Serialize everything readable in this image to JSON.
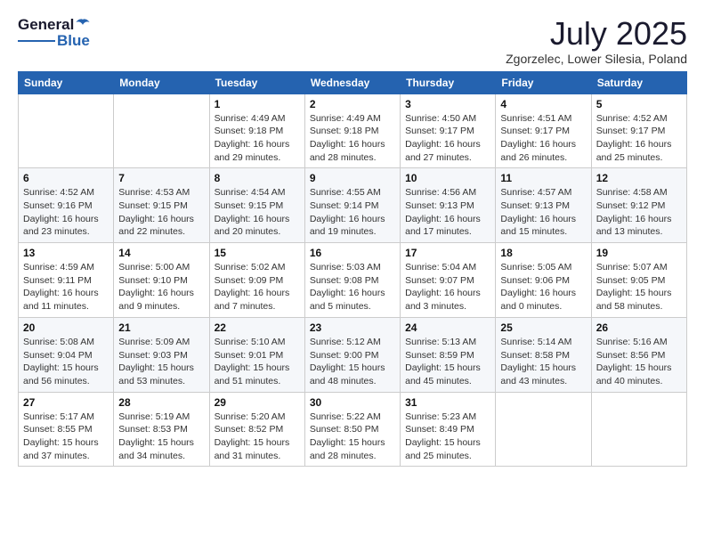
{
  "logo": {
    "general": "General",
    "blue": "Blue"
  },
  "title": "July 2025",
  "location": "Zgorzelec, Lower Silesia, Poland",
  "days_of_week": [
    "Sunday",
    "Monday",
    "Tuesday",
    "Wednesday",
    "Thursday",
    "Friday",
    "Saturday"
  ],
  "weeks": [
    [
      {
        "day": "",
        "info": ""
      },
      {
        "day": "",
        "info": ""
      },
      {
        "day": "1",
        "info": "Sunrise: 4:49 AM\nSunset: 9:18 PM\nDaylight: 16 hours\nand 29 minutes."
      },
      {
        "day": "2",
        "info": "Sunrise: 4:49 AM\nSunset: 9:18 PM\nDaylight: 16 hours\nand 28 minutes."
      },
      {
        "day": "3",
        "info": "Sunrise: 4:50 AM\nSunset: 9:17 PM\nDaylight: 16 hours\nand 27 minutes."
      },
      {
        "day": "4",
        "info": "Sunrise: 4:51 AM\nSunset: 9:17 PM\nDaylight: 16 hours\nand 26 minutes."
      },
      {
        "day": "5",
        "info": "Sunrise: 4:52 AM\nSunset: 9:17 PM\nDaylight: 16 hours\nand 25 minutes."
      }
    ],
    [
      {
        "day": "6",
        "info": "Sunrise: 4:52 AM\nSunset: 9:16 PM\nDaylight: 16 hours\nand 23 minutes."
      },
      {
        "day": "7",
        "info": "Sunrise: 4:53 AM\nSunset: 9:15 PM\nDaylight: 16 hours\nand 22 minutes."
      },
      {
        "day": "8",
        "info": "Sunrise: 4:54 AM\nSunset: 9:15 PM\nDaylight: 16 hours\nand 20 minutes."
      },
      {
        "day": "9",
        "info": "Sunrise: 4:55 AM\nSunset: 9:14 PM\nDaylight: 16 hours\nand 19 minutes."
      },
      {
        "day": "10",
        "info": "Sunrise: 4:56 AM\nSunset: 9:13 PM\nDaylight: 16 hours\nand 17 minutes."
      },
      {
        "day": "11",
        "info": "Sunrise: 4:57 AM\nSunset: 9:13 PM\nDaylight: 16 hours\nand 15 minutes."
      },
      {
        "day": "12",
        "info": "Sunrise: 4:58 AM\nSunset: 9:12 PM\nDaylight: 16 hours\nand 13 minutes."
      }
    ],
    [
      {
        "day": "13",
        "info": "Sunrise: 4:59 AM\nSunset: 9:11 PM\nDaylight: 16 hours\nand 11 minutes."
      },
      {
        "day": "14",
        "info": "Sunrise: 5:00 AM\nSunset: 9:10 PM\nDaylight: 16 hours\nand 9 minutes."
      },
      {
        "day": "15",
        "info": "Sunrise: 5:02 AM\nSunset: 9:09 PM\nDaylight: 16 hours\nand 7 minutes."
      },
      {
        "day": "16",
        "info": "Sunrise: 5:03 AM\nSunset: 9:08 PM\nDaylight: 16 hours\nand 5 minutes."
      },
      {
        "day": "17",
        "info": "Sunrise: 5:04 AM\nSunset: 9:07 PM\nDaylight: 16 hours\nand 3 minutes."
      },
      {
        "day": "18",
        "info": "Sunrise: 5:05 AM\nSunset: 9:06 PM\nDaylight: 16 hours\nand 0 minutes."
      },
      {
        "day": "19",
        "info": "Sunrise: 5:07 AM\nSunset: 9:05 PM\nDaylight: 15 hours\nand 58 minutes."
      }
    ],
    [
      {
        "day": "20",
        "info": "Sunrise: 5:08 AM\nSunset: 9:04 PM\nDaylight: 15 hours\nand 56 minutes."
      },
      {
        "day": "21",
        "info": "Sunrise: 5:09 AM\nSunset: 9:03 PM\nDaylight: 15 hours\nand 53 minutes."
      },
      {
        "day": "22",
        "info": "Sunrise: 5:10 AM\nSunset: 9:01 PM\nDaylight: 15 hours\nand 51 minutes."
      },
      {
        "day": "23",
        "info": "Sunrise: 5:12 AM\nSunset: 9:00 PM\nDaylight: 15 hours\nand 48 minutes."
      },
      {
        "day": "24",
        "info": "Sunrise: 5:13 AM\nSunset: 8:59 PM\nDaylight: 15 hours\nand 45 minutes."
      },
      {
        "day": "25",
        "info": "Sunrise: 5:14 AM\nSunset: 8:58 PM\nDaylight: 15 hours\nand 43 minutes."
      },
      {
        "day": "26",
        "info": "Sunrise: 5:16 AM\nSunset: 8:56 PM\nDaylight: 15 hours\nand 40 minutes."
      }
    ],
    [
      {
        "day": "27",
        "info": "Sunrise: 5:17 AM\nSunset: 8:55 PM\nDaylight: 15 hours\nand 37 minutes."
      },
      {
        "day": "28",
        "info": "Sunrise: 5:19 AM\nSunset: 8:53 PM\nDaylight: 15 hours\nand 34 minutes."
      },
      {
        "day": "29",
        "info": "Sunrise: 5:20 AM\nSunset: 8:52 PM\nDaylight: 15 hours\nand 31 minutes."
      },
      {
        "day": "30",
        "info": "Sunrise: 5:22 AM\nSunset: 8:50 PM\nDaylight: 15 hours\nand 28 minutes."
      },
      {
        "day": "31",
        "info": "Sunrise: 5:23 AM\nSunset: 8:49 PM\nDaylight: 15 hours\nand 25 minutes."
      },
      {
        "day": "",
        "info": ""
      },
      {
        "day": "",
        "info": ""
      }
    ]
  ]
}
